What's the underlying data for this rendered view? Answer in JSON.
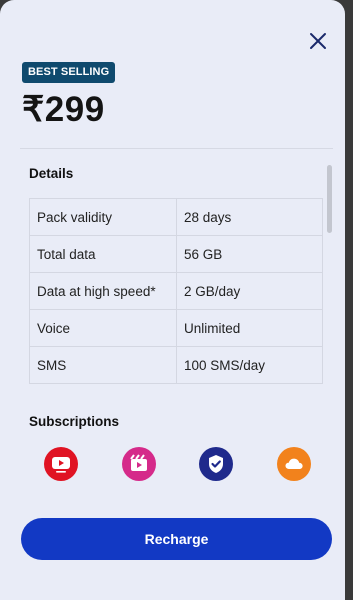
{
  "header": {
    "close_icon": "close-icon"
  },
  "plan": {
    "badge": "BEST SELLING",
    "price": "₹299"
  },
  "details": {
    "title": "Details",
    "rows": [
      {
        "label": "Pack validity",
        "value": "28 days"
      },
      {
        "label": "Total data",
        "value": "56 GB"
      },
      {
        "label": "Data at high speed*",
        "value": "2 GB/day"
      },
      {
        "label": "Voice",
        "value": "Unlimited"
      },
      {
        "label": "SMS",
        "value": "100 SMS/day"
      }
    ]
  },
  "subscriptions": {
    "title": "Subscriptions",
    "items": [
      {
        "icon": "youtube-icon",
        "color": "#e01323"
      },
      {
        "icon": "cinema-icon",
        "color": "#d52a8a"
      },
      {
        "icon": "shield-check-icon",
        "color": "#1f2a8c"
      },
      {
        "icon": "cloud-icon",
        "color": "#f2821c"
      }
    ]
  },
  "actions": {
    "recharge_label": "Recharge"
  },
  "colors": {
    "accent": "#1239c4",
    "badge_bg": "#0f4a6e",
    "background": "#e9ecf7"
  }
}
